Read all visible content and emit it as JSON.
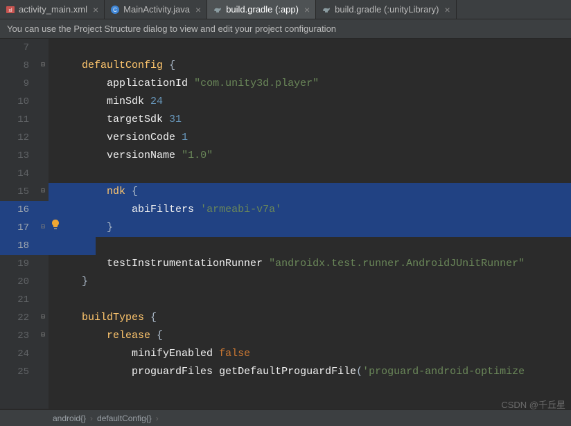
{
  "tabs": [
    {
      "label": "activity_main.xml",
      "icon": "xml"
    },
    {
      "label": "MainActivity.java",
      "icon": "java"
    },
    {
      "label": "build.gradle (:app)",
      "icon": "gradle",
      "active": true
    },
    {
      "label": "build.gradle (:unityLibrary)",
      "icon": "gradle"
    }
  ],
  "info_bar": "You can use the Project Structure dialog to view and edit your project configuration",
  "lines": {
    "7": "",
    "8": "    defaultConfig {",
    "9": "        applicationId \"com.unity3d.player\"",
    "10": "        minSdk 24",
    "11": "        targetSdk 31",
    "12": "        versionCode 1",
    "13": "        versionName \"1.0\"",
    "14": "",
    "15": "        ndk {",
    "16": "            abiFilters 'armeabi-v7a'",
    "17": "        }",
    "18": "",
    "19": "        testInstrumentationRunner \"androidx.test.runner.AndroidJUnitRunner\"",
    "20": "    }",
    "21": "",
    "22": "    buildTypes {",
    "23": "        release {",
    "24": "            minifyEnabled false",
    "25": "            proguardFiles getDefaultProguardFile('proguard-android-optimize"
  },
  "line_numbers": [
    "7",
    "8",
    "9",
    "10",
    "11",
    "12",
    "13",
    "14",
    "15",
    "16",
    "17",
    "18",
    "19",
    "20",
    "21",
    "22",
    "23",
    "24",
    "25"
  ],
  "breadcrumbs": [
    "android{}",
    "defaultConfig{}"
  ],
  "watermark": "CSDN @千丘星"
}
